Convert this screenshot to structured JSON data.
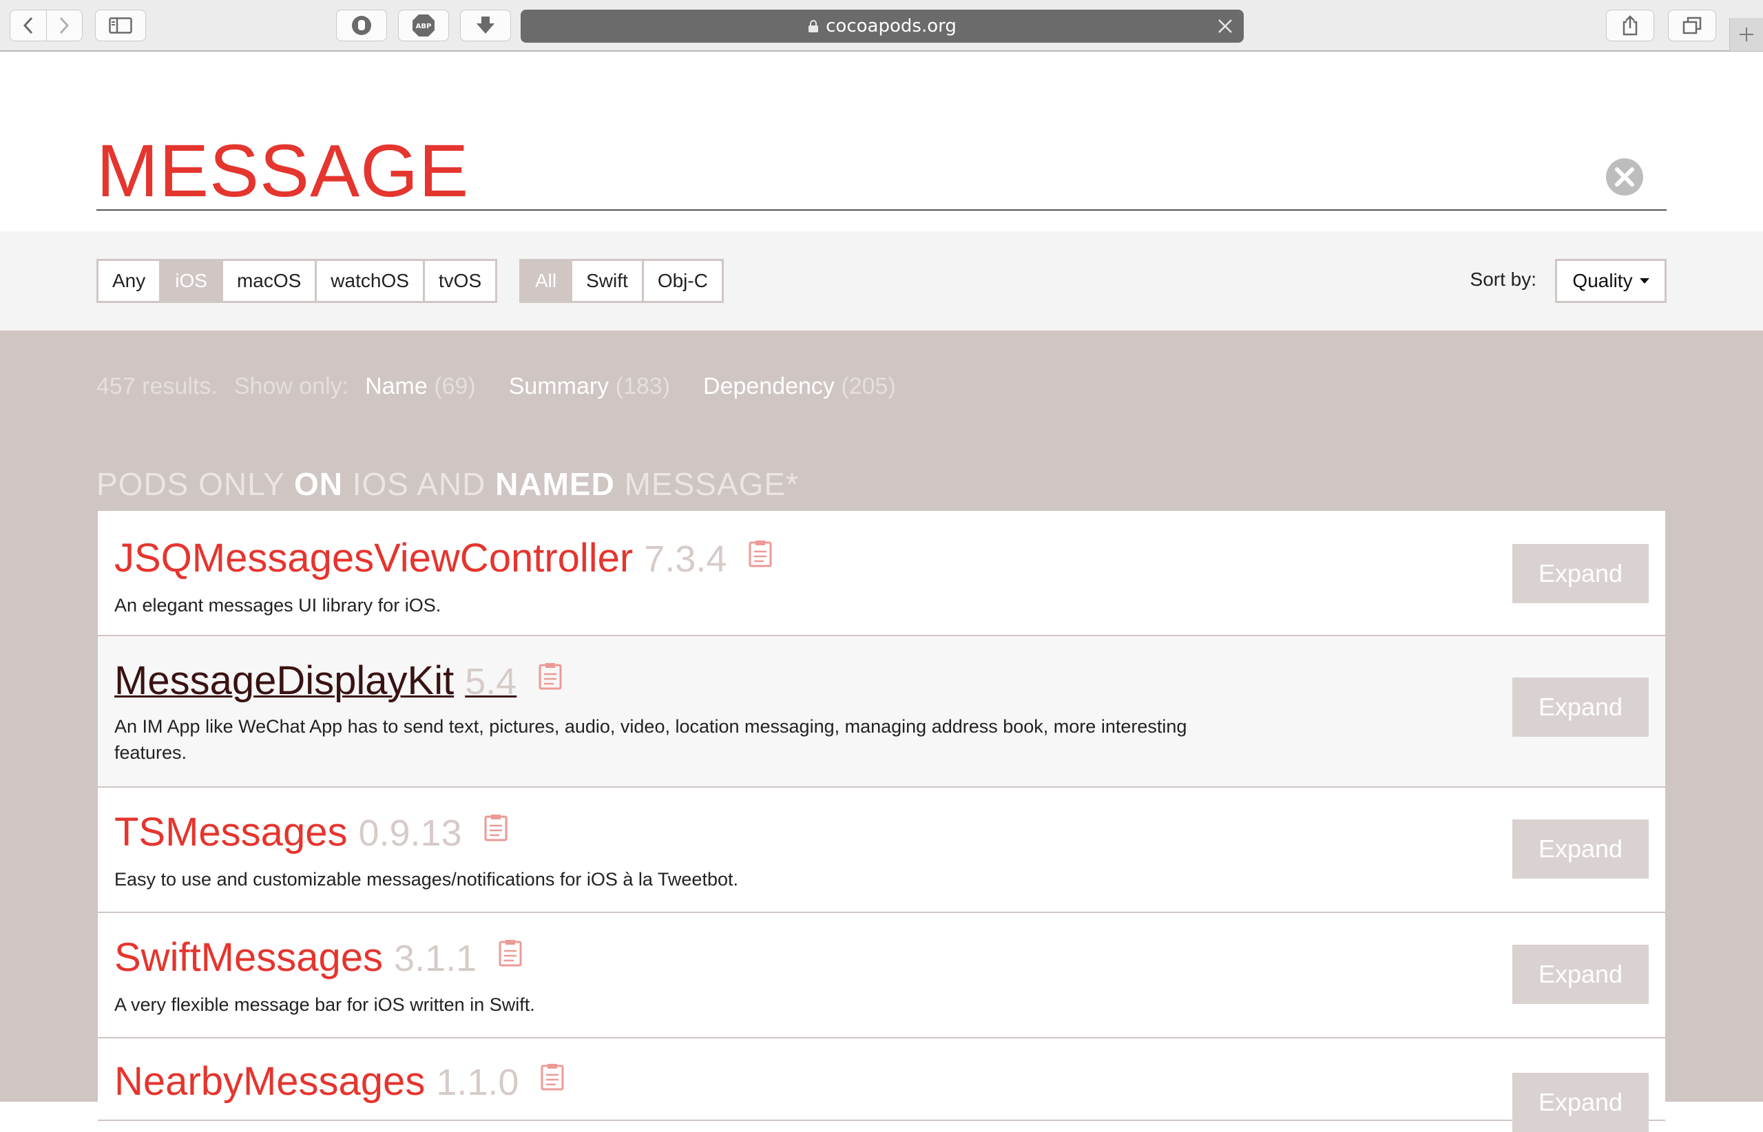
{
  "browser": {
    "url": "cocoapods.org"
  },
  "search": {
    "query": "MESSAGE"
  },
  "filters": {
    "platforms": [
      "Any",
      "iOS",
      "macOS",
      "watchOS",
      "tvOS"
    ],
    "platform_active": "iOS",
    "languages": [
      "All",
      "Swift",
      "Obj-C"
    ],
    "language_active": "All",
    "sort_label": "Sort by:",
    "sort_value": "Quality"
  },
  "results": {
    "count_text": "457 results.",
    "show_only_label": "Show only:",
    "name_label": "Name",
    "name_count": "(69)",
    "summary_label": "Summary",
    "summary_count": "(183)",
    "dependency_label": "Dependency",
    "dependency_count": "(205)",
    "heading_parts": [
      "PODS ONLY ",
      "ON",
      " IOS AND ",
      "NAMED",
      " MESSAGE*"
    ]
  },
  "pods": [
    {
      "name": "JSQMessagesViewController",
      "version": "7.3.4",
      "description": "An elegant messages UI library for iOS.",
      "expand_label": "Expand"
    },
    {
      "name": "MessageDisplayKit",
      "version": "5.4",
      "description": "An IM App like WeChat App has to send text, pictures, audio, video, location messaging, managing address book, more interesting features.",
      "expand_label": "Expand"
    },
    {
      "name": "TSMessages",
      "version": "0.9.13",
      "description": "Easy to use and customizable messages/notifications for iOS à la Tweetbot.",
      "expand_label": "Expand"
    },
    {
      "name": "SwiftMessages",
      "version": "3.1.1",
      "description": "A very flexible message bar for iOS written in Swift.",
      "expand_label": "Expand"
    },
    {
      "name": "NearbyMessages",
      "version": "1.1.0",
      "description": "",
      "expand_label": "Expand"
    }
  ],
  "colors": {
    "accent": "#e4352e",
    "results_bg": "#cfc5c2",
    "expand_bg": "#d9d2d0"
  }
}
